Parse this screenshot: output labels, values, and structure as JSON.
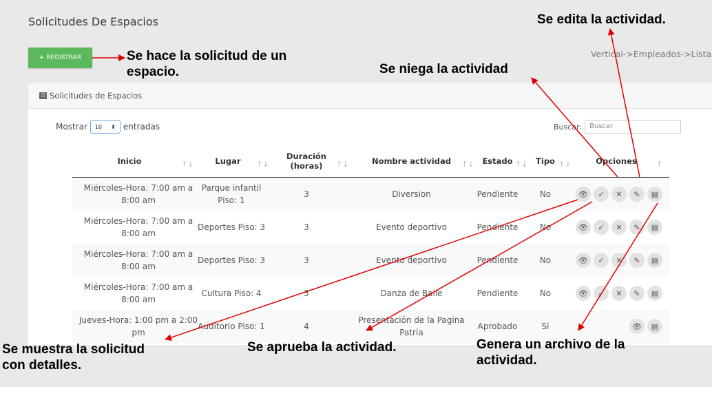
{
  "page": {
    "title": "Solicitudes De Espacios",
    "register_label": "+ REGISTRAR",
    "breadcrumb": "Vertical->Empleados->Listado"
  },
  "panel": {
    "title": "Solicitudes de Espacios",
    "show_label": "Mostrar",
    "length_value": "10",
    "entries_label": "entradas",
    "search_label": "Buscar:",
    "search_placeholder": "Buscar"
  },
  "table": {
    "columns": [
      "Inicio",
      "Lugar",
      "Duración (horas)",
      "Nombre actividad",
      "Estado",
      "Tipo",
      "Opciones"
    ],
    "rows": [
      {
        "inicio": "Miércoles-Hora: 7:00 am a 8:00 am",
        "lugar": "Parque infantil Piso: 1",
        "duracion": "3",
        "nombre": "Diversion",
        "estado": "Pendiente",
        "tipo": "No",
        "options": [
          "eye-icon",
          "check-shield-icon",
          "reject-icon",
          "pencil-icon",
          "pdf-icon"
        ]
      },
      {
        "inicio": "Miércoles-Hora: 7:00 am a 8:00 am",
        "lugar": "Deportes Piso: 3",
        "duracion": "3",
        "nombre": "Evento deportivo",
        "estado": "Pendiente",
        "tipo": "No",
        "options": [
          "eye-icon",
          "check-shield-icon",
          "reject-icon",
          "pencil-icon",
          "pdf-icon"
        ]
      },
      {
        "inicio": "Miércoles-Hora: 7:00 am a 8:00 am",
        "lugar": "Deportes Piso: 3",
        "duracion": "3",
        "nombre": "Evento deportivo",
        "estado": "Pendiente",
        "tipo": "No",
        "options": [
          "eye-icon",
          "check-shield-icon",
          "reject-icon",
          "pencil-icon",
          "pdf-icon"
        ]
      },
      {
        "inicio": "Miércoles-Hora: 7:00 am a 8:00 am",
        "lugar": "Cultura Piso: 4",
        "duracion": "3",
        "nombre": "Danza de Baile",
        "estado": "Pendiente",
        "tipo": "No",
        "options": [
          "eye-icon",
          "check-shield-icon",
          "reject-icon",
          "pencil-icon",
          "pdf-icon"
        ]
      },
      {
        "inicio": "Jueves-Hora: 1:00 pm a 2:00 pm",
        "lugar": "Auditorio Piso: 1",
        "duracion": "4",
        "nombre": "Presentación de la Pagina Patria",
        "estado": "Aprobado",
        "tipo": "Si",
        "options": [
          "eye-icon",
          "pdf-icon"
        ]
      }
    ]
  },
  "annotations": {
    "register": "Se hace la solicitud de un espacio.",
    "edit": "Se edita la actividad.",
    "deny": "Se niega la actividad",
    "show": "Se muestra la solicitud con detalles.",
    "approve": "Se aprueba la actividad.",
    "generate": "Genera un archivo de la actividad."
  },
  "colors": {
    "register_button": "#5cb85c",
    "arrow": "#e00000",
    "background": "#e9e9e9"
  }
}
